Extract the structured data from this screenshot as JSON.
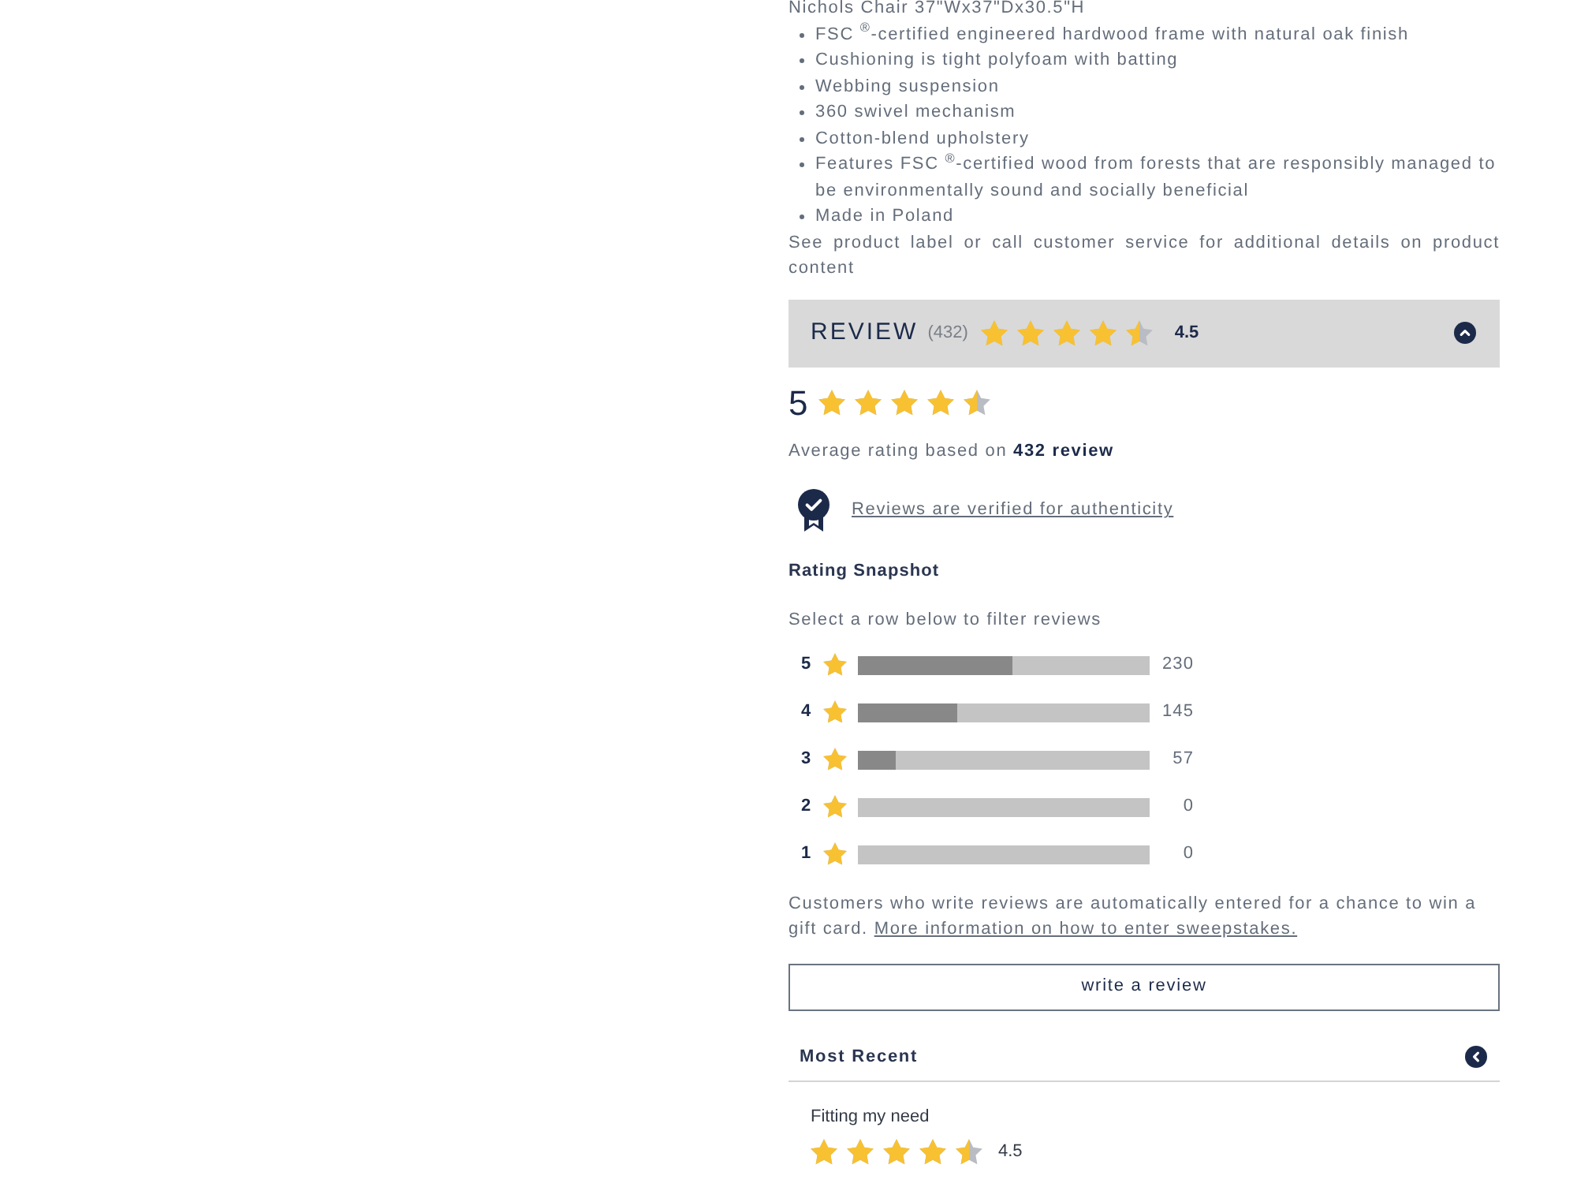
{
  "description": {
    "title": "Nichols Chair 37\"Wx37\"Dx30.5\"H",
    "features": [
      "FSC $^{®}$-certified engineered hardwood frame with natural oak finish",
      "Cushioning is tight polyfoam with batting",
      "Webbing suspension",
      "360 swivel mechanism",
      "Cotton-blend upholstery",
      "Features FSC $^{®}$-certified wood from forests that are responsibly managed to be environmentally sound and socially beneficial",
      "Made in Poland"
    ],
    "note": "See product label or call customer service for additional details on product content"
  },
  "review_header": {
    "title": "REVIEW",
    "count": "(432)",
    "stars": 4.5,
    "rating": "4.5",
    "expanded": true
  },
  "summary": {
    "score": "5",
    "stars": 4.5,
    "average_text": "Average rating based on **432 review**"
  },
  "verified": {
    "link": "Reviews are verified for authenticity"
  },
  "snapshot": {
    "title": "Rating Snapshot",
    "hint": "Select a row below to filter reviews",
    "rows": [
      {
        "label": "5",
        "level": 0.53,
        "count": "230"
      },
      {
        "label": "4",
        "level": 0.34,
        "count": "145"
      },
      {
        "label": "3",
        "level": 0.13,
        "count": "57"
      },
      {
        "label": "2",
        "level": 0,
        "count": "0"
      },
      {
        "label": "1",
        "level": 0,
        "count": "0"
      }
    ]
  },
  "sweepstakes": {
    "text": "Customers who write reviews are automatically entered for a chance to win a gift card.",
    "link": "More information on how to enter sweepstakes."
  },
  "write_button": {
    "label": "write a review"
  },
  "sort": {
    "label": "Most Recent",
    "expanded": false
  },
  "reviews": [
    {
      "title": "Fitting my need",
      "stars": 4.5,
      "rating": "4.5"
    }
  ]
}
